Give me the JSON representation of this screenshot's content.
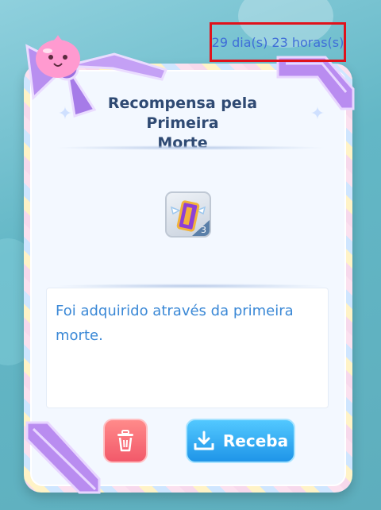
{
  "timer": {
    "text": "29 dia(s) 23 horas(s)"
  },
  "panel": {
    "title_line1": "Recompensa pela Primeira",
    "title_line2": "Morte"
  },
  "reward": {
    "item_icon": "winged-ticket-icon",
    "quantity": "3"
  },
  "description": {
    "line1": "Foi adquirido através da primeira",
    "line2": "morte."
  },
  "actions": {
    "delete_icon": "trash-icon",
    "receive_label": "Receba"
  },
  "colors": {
    "timer_border": "#e0121b",
    "timer_text": "#3f6ed8",
    "title_text": "#2f4a73",
    "description_text": "#3a88d6",
    "delete_button": "#f2596a",
    "receive_button": "#1f95e8"
  }
}
